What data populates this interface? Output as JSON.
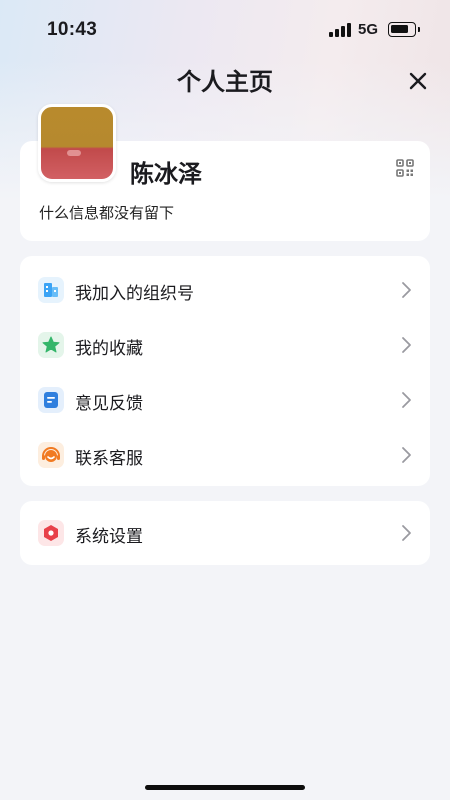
{
  "status_bar": {
    "time": "10:43",
    "network": "5G"
  },
  "header": {
    "title": "个人主页"
  },
  "profile": {
    "name": "陈冰泽",
    "bio": "什么信息都没有留下"
  },
  "menu": {
    "items": [
      {
        "label": "我加入的组织号",
        "icon": "building-icon",
        "color": "#3aa3f5"
      },
      {
        "label": "我的收藏",
        "icon": "star-icon",
        "color": "#34b66a"
      },
      {
        "label": "意见反馈",
        "icon": "feedback-icon",
        "color": "#2f7fde"
      },
      {
        "label": "联系客服",
        "icon": "headset-icon",
        "color": "#f17a22"
      }
    ]
  },
  "settings": {
    "label": "系统设置",
    "icon": "settings-hexagon-icon",
    "color": "#e8414a"
  }
}
